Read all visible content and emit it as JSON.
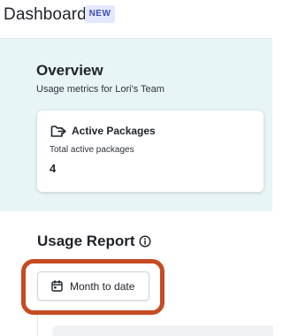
{
  "header": {
    "title": "Dashboard",
    "badge": "NEW"
  },
  "overview": {
    "title": "Overview",
    "subtitle": "Usage metrics for Lori's Team",
    "card": {
      "icon": "package-export-icon",
      "title": "Active Packages",
      "label": "Total active packages",
      "value": "4"
    }
  },
  "usage_report": {
    "title": "Usage Report",
    "info_icon": "info-circle-icon",
    "date_button": {
      "icon": "calendar-icon",
      "label": "Month to date"
    }
  },
  "colors": {
    "overview_background": "#e8f5f7",
    "badge_background": "#e3e8ff",
    "badge_text": "#3d4fb8",
    "highlight_ring": "#c64a22"
  }
}
